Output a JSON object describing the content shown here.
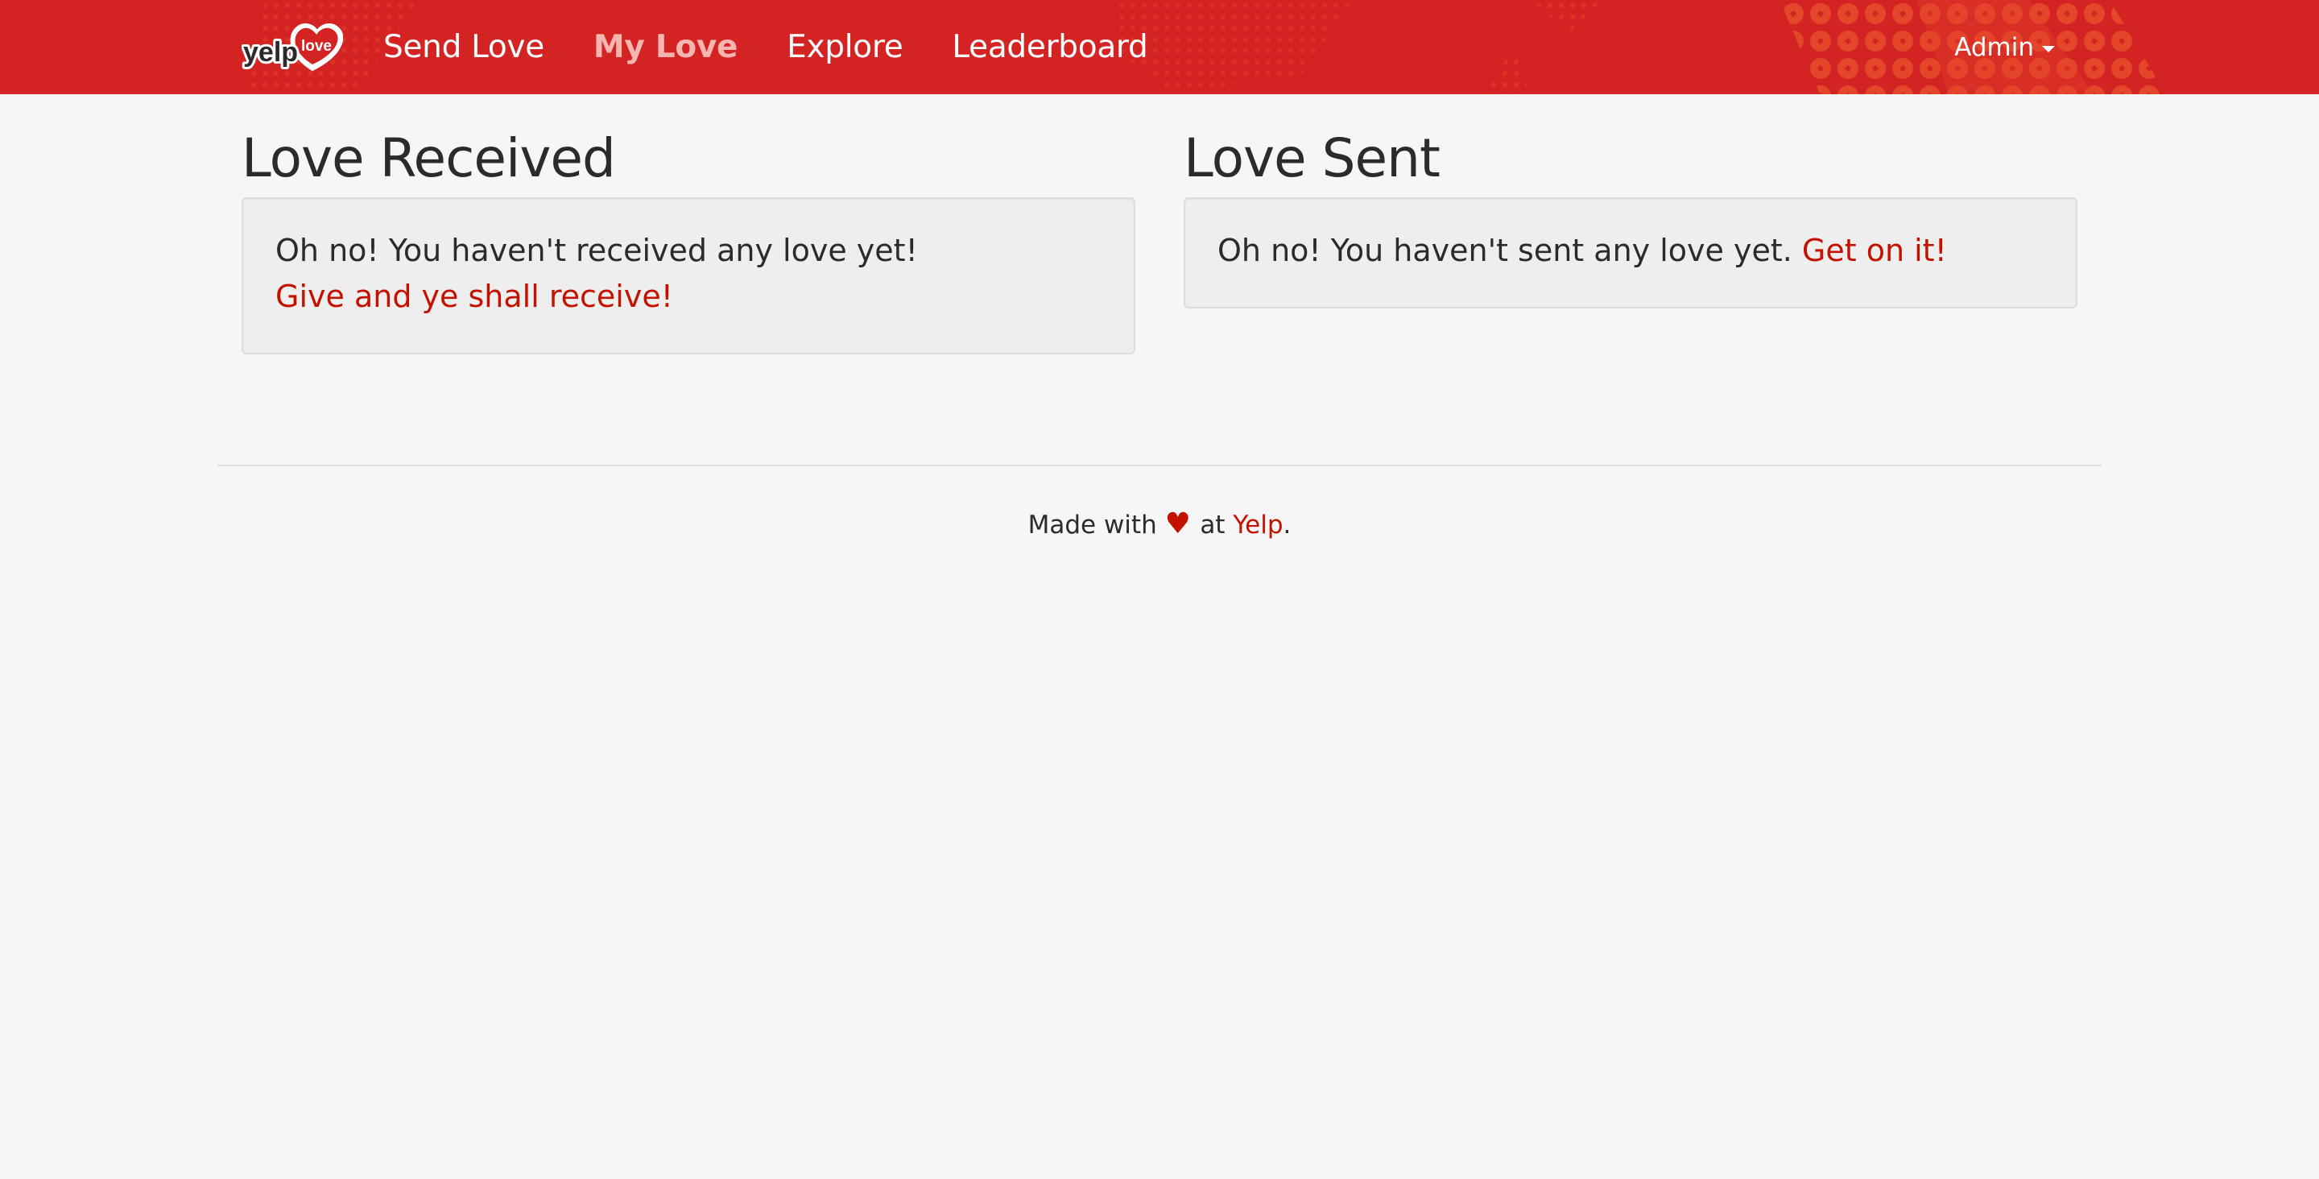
{
  "colors": {
    "brand_red": "#d32323",
    "link_red": "#c41200",
    "background": "#f6f6f6",
    "panel": "#eeeeee"
  },
  "navbar": {
    "brand": {
      "logo_text_yelp": "yelp",
      "logo_text_love": "love",
      "icon": "heart-logo-icon"
    },
    "links": [
      {
        "label": "Send Love",
        "active": false
      },
      {
        "label": "My Love",
        "active": true
      },
      {
        "label": "Explore",
        "active": false
      },
      {
        "label": "Leaderboard",
        "active": false
      }
    ],
    "user_menu": {
      "label": "Admin",
      "icon": "caret-down-icon"
    }
  },
  "love_received": {
    "title": "Love Received",
    "empty_message": "Oh no! You haven't received any love yet!",
    "cta_link": "Give and ye shall receive!"
  },
  "love_sent": {
    "title": "Love Sent",
    "empty_message": "Oh no! You haven't sent any love yet.",
    "cta_link": "Get on it!"
  },
  "footer": {
    "prefix": "Made with",
    "heart": "♥",
    "middle": "at",
    "link": "Yelp",
    "suffix": "."
  }
}
